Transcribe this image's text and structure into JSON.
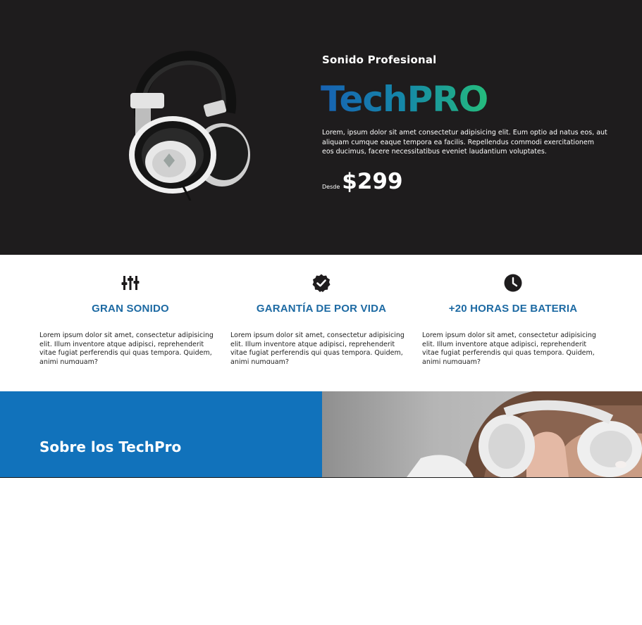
{
  "hero": {
    "kicker": "Sonido Profesional",
    "brand": "TechPRO",
    "description": "Lorem, ipsum dolor sit amet consectetur adipisicing elit. Eum optio ad natus eos, aut aliquam cumque eaque tempora ea facilis. Repellendus commodi exercitationem eos ducimus, facere necessitatibus eveniet laudantium voluptates.",
    "price_label": "Desde",
    "price": "$299"
  },
  "features": [
    {
      "icon": "sliders-icon",
      "title": "GRAN SONIDO",
      "text": "Lorem ipsum dolor sit amet, consectetur adipisicing elit. Illum inventore atque adipisci, reprehenderit vitae fugiat perferendis qui quas tempora. Quidem, animi numquam?"
    },
    {
      "icon": "badge-check-icon",
      "title": "GARANTÍA DE POR VIDA",
      "text": "Lorem ipsum dolor sit amet, consectetur adipisicing elit. Illum inventore atque adipisci, reprehenderit vitae fugiat perferendis qui quas tempora. Quidem, animi numquam?"
    },
    {
      "icon": "clock-icon",
      "title": "+20 HORAS DE BATERIA",
      "text": "Lorem ipsum dolor sit amet, consectetur adipisicing elit. Illum inventore atque adipisci, reprehenderit vitae fugiat perferendis qui quas tempora. Quidem, animi numquam?"
    }
  ],
  "about": {
    "title": "Sobre los TechPro"
  },
  "colors": {
    "hero_bg": "#1e1c1d",
    "accent_blue": "#1172bb",
    "feature_title": "#1d6aa3",
    "brand_gradient_start": "#1762b3",
    "brand_gradient_end": "#25bc7d"
  }
}
